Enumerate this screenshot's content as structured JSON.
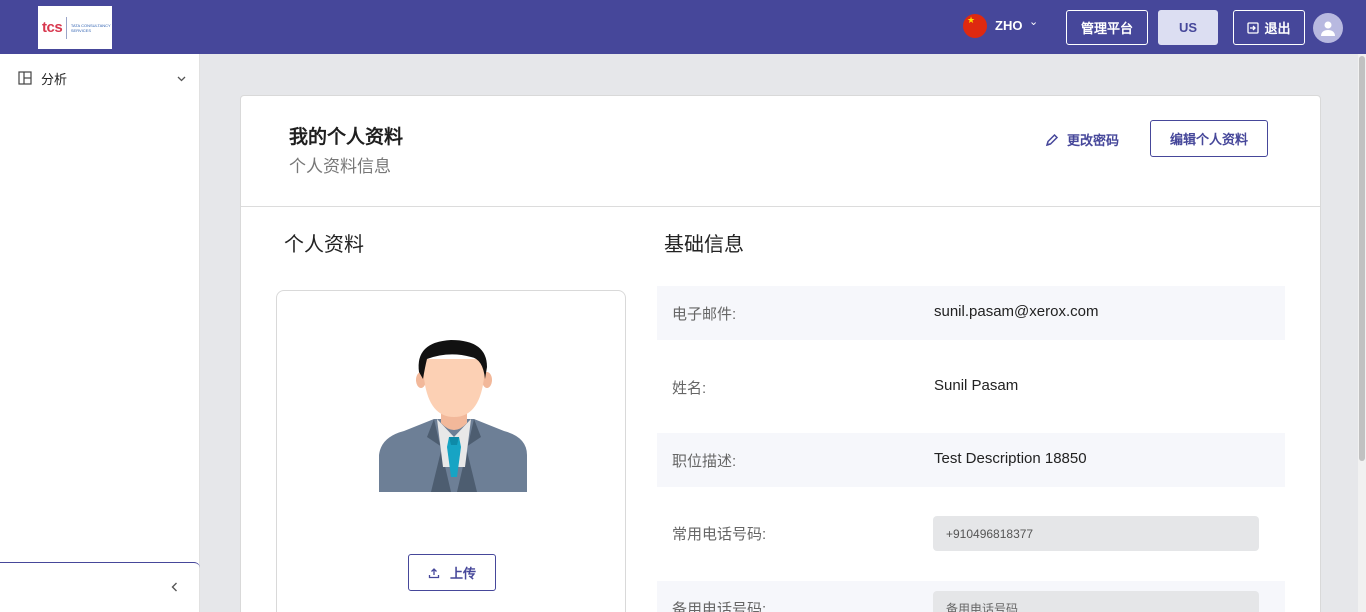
{
  "header": {
    "logo": {
      "brand": "tcs",
      "subtext": "TATA CONSULTANCY SERVICES"
    },
    "language_flag": "china-flag-icon",
    "language_code": "ZHO",
    "admin_label": "管理平台",
    "region_label": "US",
    "logout_label": "退出",
    "colors": {
      "bar": "#46479a",
      "accent": "#46479a"
    }
  },
  "sidebar": {
    "items": [
      {
        "label": "分析",
        "icon": "panel-icon"
      }
    ]
  },
  "page": {
    "title": "我的个人资料",
    "subtitle": "个人资料信息",
    "change_password_label": "更改密码",
    "edit_profile_label": "编辑个人资料"
  },
  "profile_section": {
    "heading": "个人资料",
    "upload_label": "上传"
  },
  "basic_info": {
    "heading": "基础信息",
    "rows": [
      {
        "label": "电子邮件:",
        "value": "sunil.pasam@xerox.com"
      },
      {
        "label": "姓名:",
        "value": "Sunil Pasam"
      },
      {
        "label": "职位描述:",
        "value": "Test Description 18850"
      },
      {
        "label": "常用电话号码:",
        "input_value": "+910496818377"
      },
      {
        "label": "备用电话号码:",
        "placeholder": "备用电话号码"
      }
    ]
  }
}
